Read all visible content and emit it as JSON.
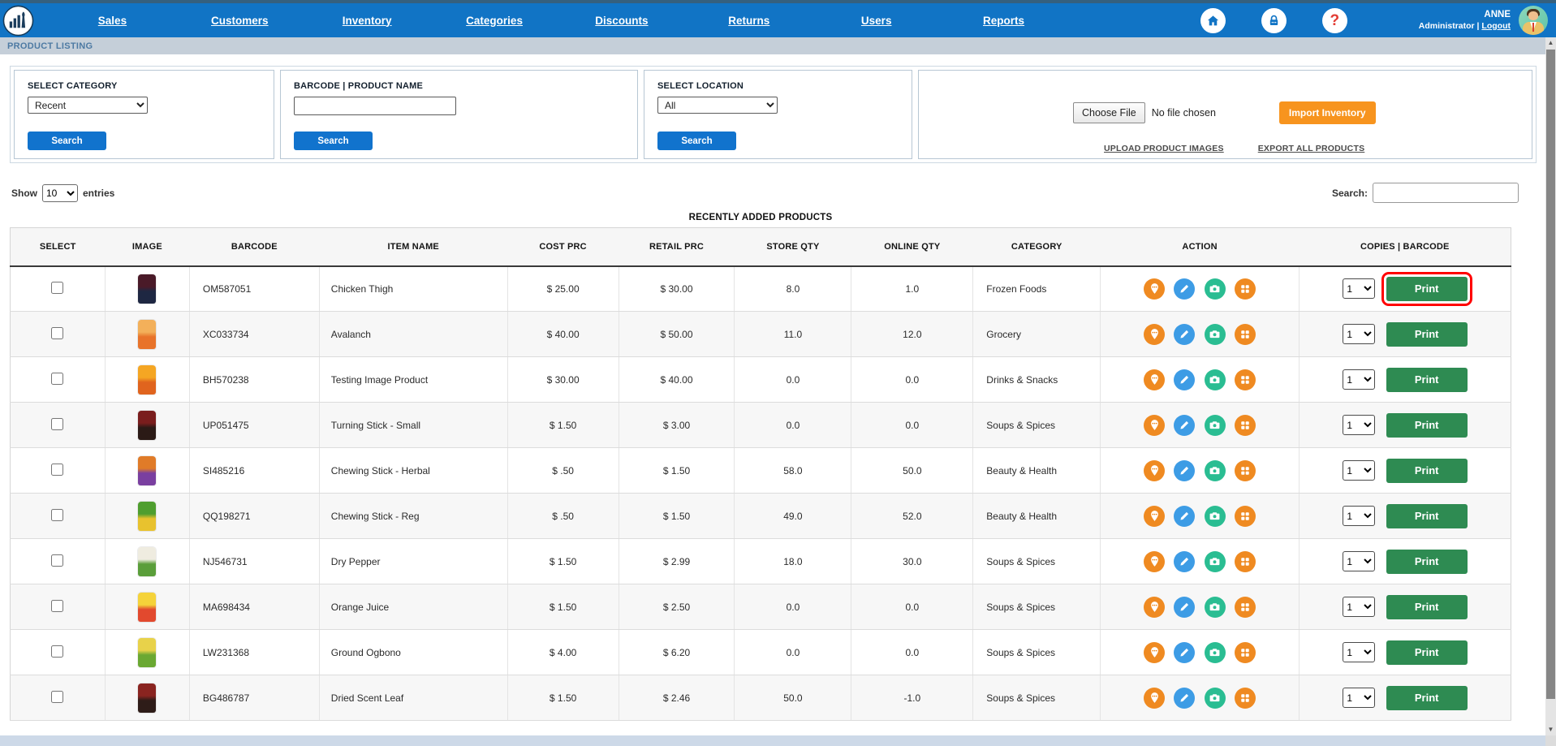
{
  "nav": {
    "items": [
      "Sales",
      "Customers",
      "Inventory",
      "Categories",
      "Discounts",
      "Returns",
      "Users",
      "Reports"
    ],
    "help_icon": "?",
    "user_name": "ANNE",
    "user_role": "Administrator",
    "user_separator": "|",
    "logout_label": "Logout"
  },
  "breadcrumb": "PRODUCT LISTING",
  "filters": {
    "category": {
      "label": "SELECT CATEGORY",
      "value": "Recent",
      "button": "Search"
    },
    "barcode": {
      "label": "BARCODE | PRODUCT NAME",
      "value": "",
      "button": "Search"
    },
    "location": {
      "label": "SELECT LOCATION",
      "value": "All",
      "button": "Search"
    },
    "import": {
      "choose_file": "Choose File",
      "no_file": "No file chosen",
      "import_button": "Import Inventory",
      "upload_link": "UPLOAD PRODUCT IMAGES",
      "export_link": "EXPORT ALL PRODUCTS"
    }
  },
  "table_controls": {
    "show_label": "Show",
    "entries_value": "10",
    "entries_label": "entries",
    "search_label": "Search:",
    "search_value": ""
  },
  "table": {
    "title": "RECENTLY ADDED PRODUCTS",
    "columns": [
      "SELECT",
      "IMAGE",
      "BARCODE",
      "ITEM NAME",
      "COST PRC",
      "RETAIL PRC",
      "STORE QTY",
      "ONLINE QTY",
      "CATEGORY",
      "ACTION",
      "COPIES | BARCODE"
    ],
    "copies_value": "1",
    "print_label": "Print",
    "rows": [
      {
        "barcode": "OM587051",
        "item": "Chicken Thigh",
        "cost": "$ 25.00",
        "retail": "$ 30.00",
        "store_qty": "8.0",
        "online_qty": "1.0",
        "category": "Frozen Foods",
        "img_top": "#4a1a28",
        "img_bottom": "#1e2742",
        "print_highlighted": true
      },
      {
        "barcode": "XC033734",
        "item": "Avalanch",
        "cost": "$ 40.00",
        "retail": "$ 50.00",
        "store_qty": "11.0",
        "online_qty": "12.0",
        "category": "Grocery",
        "img_top": "#f3b05a",
        "img_bottom": "#e8732a",
        "print_highlighted": false
      },
      {
        "barcode": "BH570238",
        "item": "Testing Image Product",
        "cost": "$ 30.00",
        "retail": "$ 40.00",
        "store_qty": "0.0",
        "online_qty": "0.0",
        "category": "Drinks & Snacks",
        "img_top": "#f5a623",
        "img_bottom": "#e0641e",
        "print_highlighted": false
      },
      {
        "barcode": "UP051475",
        "item": "Turning Stick - Small",
        "cost": "$ 1.50",
        "retail": "$ 3.00",
        "store_qty": "0.0",
        "online_qty": "0.0",
        "category": "Soups & Spices",
        "img_top": "#7a1d1d",
        "img_bottom": "#2b1a16",
        "print_highlighted": false
      },
      {
        "barcode": "SI485216",
        "item": "Chewing Stick - Herbal",
        "cost": "$ .50",
        "retail": "$ 1.50",
        "store_qty": "58.0",
        "online_qty": "50.0",
        "category": "Beauty & Health",
        "img_top": "#e07b28",
        "img_bottom": "#7a3fa0",
        "print_highlighted": false
      },
      {
        "barcode": "QQ198271",
        "item": "Chewing Stick - Reg",
        "cost": "$ .50",
        "retail": "$ 1.50",
        "store_qty": "49.0",
        "online_qty": "52.0",
        "category": "Beauty & Health",
        "img_top": "#4f9e2f",
        "img_bottom": "#e8c22e",
        "print_highlighted": false
      },
      {
        "barcode": "NJ546731",
        "item": "Dry Pepper",
        "cost": "$ 1.50",
        "retail": "$ 2.99",
        "store_qty": "18.0",
        "online_qty": "30.0",
        "category": "Soups & Spices",
        "img_top": "#efece0",
        "img_bottom": "#5a9e3a",
        "print_highlighted": false
      },
      {
        "barcode": "MA698434",
        "item": "Orange Juice",
        "cost": "$ 1.50",
        "retail": "$ 2.50",
        "store_qty": "0.0",
        "online_qty": "0.0",
        "category": "Soups & Spices",
        "img_top": "#f5d33a",
        "img_bottom": "#e2492e",
        "print_highlighted": false
      },
      {
        "barcode": "LW231368",
        "item": "Ground Ogbono",
        "cost": "$ 4.00",
        "retail": "$ 6.20",
        "store_qty": "0.0",
        "online_qty": "0.0",
        "category": "Soups & Spices",
        "img_top": "#e8d24a",
        "img_bottom": "#6aa832",
        "print_highlighted": false
      },
      {
        "barcode": "BG486787",
        "item": "Dried Scent Leaf",
        "cost": "$ 1.50",
        "retail": "$ 2.46",
        "store_qty": "50.0",
        "online_qty": "-1.0",
        "category": "Soups & Spices",
        "img_top": "#8a2420",
        "img_bottom": "#2e1c18",
        "print_highlighted": false
      }
    ]
  },
  "colors": {
    "nav_blue": "#1174c5",
    "button_blue": "#1173cd",
    "import_orange": "#f7941e",
    "print_green": "#2e8b52",
    "icon_orange": "#ef8a21",
    "icon_blue": "#3d9ce5",
    "icon_green": "#2abd92",
    "highlight_red": "#ff0000"
  }
}
